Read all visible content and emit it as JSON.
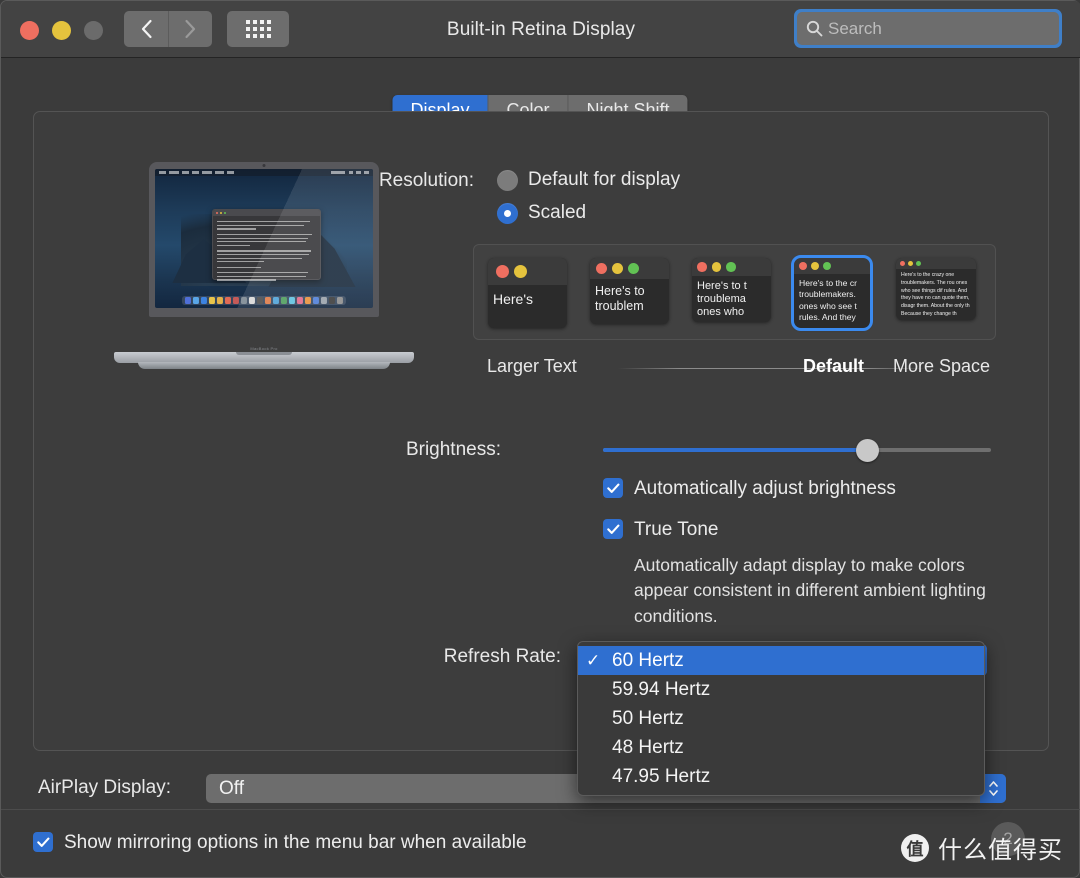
{
  "window": {
    "title": "Built-in Retina Display",
    "traffic_lights": [
      "close",
      "minimize",
      "zoom"
    ]
  },
  "toolbar": {
    "back_icon": "chevron-left-icon",
    "forward_icon": "chevron-right-icon",
    "grid_icon": "show-all-grid-icon",
    "search": {
      "placeholder": "Search",
      "value": "",
      "icon": "search-icon"
    }
  },
  "tabs": [
    {
      "label": "Display",
      "active": true
    },
    {
      "label": "Color",
      "active": false
    },
    {
      "label": "Night Shift",
      "active": false
    }
  ],
  "preview": {
    "device_label": "MacBook Pro",
    "document_text": "Here's to the crazy ones."
  },
  "resolution": {
    "label": "Resolution:",
    "options": [
      {
        "label": "Default for display",
        "selected": false
      },
      {
        "label": "Scaled",
        "selected": true
      }
    ]
  },
  "scaling": {
    "thumbnails": [
      {
        "text": "Here's",
        "selected": false
      },
      {
        "text": "Here's to troublem",
        "selected": false
      },
      {
        "text": "Here's to t troublema ones who",
        "selected": false
      },
      {
        "text": "Here's to the cr troublemakers. ones who see t rules. And they",
        "selected": true
      },
      {
        "text": "Here's to the crazy one troublemakers. The rou ones who see things dif rules. And they have no can quote them, disagr them. About the only th Because they change th",
        "selected": false
      }
    ],
    "left_label": "Larger Text",
    "default_label": "Default",
    "right_label": "More Space"
  },
  "brightness": {
    "label": "Brightness:",
    "value_percent": 68
  },
  "auto_brightness": {
    "label": "Automatically adjust brightness",
    "checked": true
  },
  "true_tone": {
    "label": "True Tone",
    "checked": true,
    "description": "Automatically adapt display to make colors appear consistent in different ambient lighting conditions."
  },
  "refresh_rate": {
    "label": "Refresh Rate:",
    "selected": "60 Hertz",
    "options": [
      {
        "label": "60 Hertz",
        "checked": true,
        "highlighted": true
      },
      {
        "label": "59.94 Hertz",
        "checked": false,
        "highlighted": false
      },
      {
        "label": "50 Hertz",
        "checked": false,
        "highlighted": false
      },
      {
        "label": "48 Hertz",
        "checked": false,
        "highlighted": false
      },
      {
        "label": "47.95 Hertz",
        "checked": false,
        "highlighted": false
      }
    ],
    "checkmark": "✓"
  },
  "airplay": {
    "label": "AirPlay Display:",
    "value": "Off"
  },
  "mirroring": {
    "label": "Show mirroring options in the menu bar when available",
    "checked": true
  },
  "watermark": {
    "logo_char": "值",
    "text": "什么值得买",
    "ghost_char": "2"
  },
  "colors": {
    "accent_blue": "#2f6fd0",
    "highlight_blue": "#3b8aee",
    "window_bg": "#3b3b3b",
    "toolbar_bg": "#434343",
    "control_gray": "#6d6d6d",
    "traffic_red": "#ef6f60",
    "traffic_yellow": "#e5c33d",
    "traffic_gray": "#6b6b6b"
  }
}
